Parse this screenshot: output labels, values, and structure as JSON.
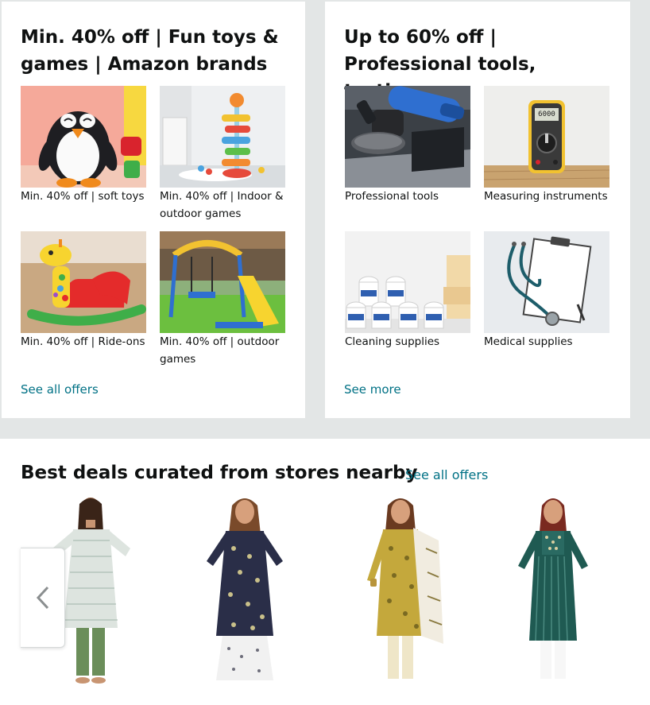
{
  "cards": [
    {
      "title": "Min. 40% off | Fun toys & games | Amazon brands",
      "tiles": [
        {
          "caption": "Min. 40% off | soft toys",
          "image": "penguin-plush"
        },
        {
          "caption": "Min. 40% off | Indoor & outdoor games",
          "image": "ball-tower"
        },
        {
          "caption": "Min. 40% off | Ride-ons",
          "image": "giraffe-rocker"
        },
        {
          "caption": "Min. 40% off | outdoor games",
          "image": "swing-slide"
        }
      ],
      "link": "See all offers"
    },
    {
      "title": "Up to 60% off | Professional tools, testin…",
      "tiles": [
        {
          "caption": "Professional tools",
          "image": "angle-grinder"
        },
        {
          "caption": "Measuring instruments",
          "image": "multimeter"
        },
        {
          "caption": "Cleaning supplies",
          "image": "tissue-rolls"
        },
        {
          "caption": "Medical supplies",
          "image": "stethoscope"
        }
      ],
      "link": "See more"
    }
  ],
  "multimeter_display": "6000",
  "strip": {
    "title": "Best deals curated from stores nearby",
    "link": "See all offers",
    "products": [
      {
        "image": "kurta-mint-stripe"
      },
      {
        "image": "kurta-navy-print"
      },
      {
        "image": "kurta-mustard-dupatta"
      },
      {
        "image": "kurta-teal-stripe"
      }
    ],
    "prev_icon": "chevron-left-icon"
  },
  "colors": {
    "link": "#007185",
    "background": "#e3e6e6",
    "text": "#0f1111"
  }
}
